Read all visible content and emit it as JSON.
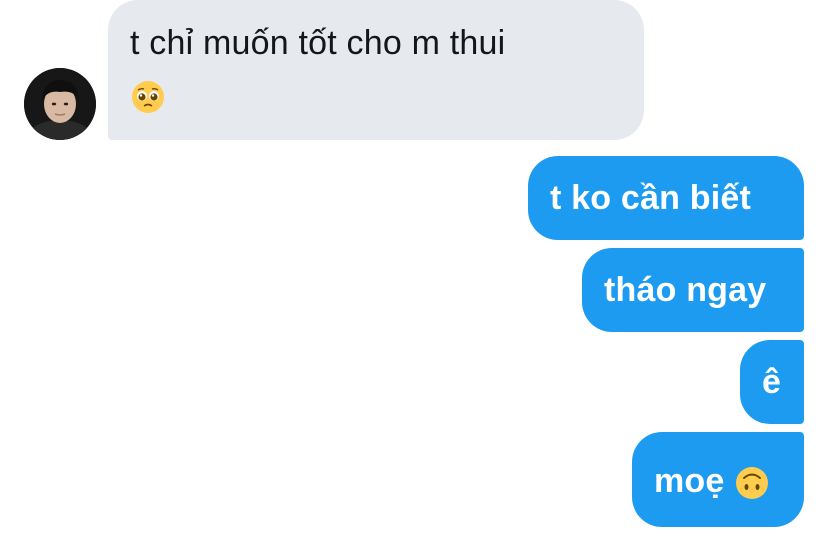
{
  "conversation": {
    "incoming": {
      "text": "t chỉ muốn tốt cho m thui",
      "emoji": "pleading-face-icon"
    },
    "outgoing": [
      {
        "text": "t ko cần biết"
      },
      {
        "text": "tháo ngay"
      },
      {
        "text": "ê"
      },
      {
        "text": "moẹ",
        "emoji": "upside-down-face-icon"
      }
    ]
  },
  "colors": {
    "incoming_bubble": "#e6eaef",
    "outgoing_bubble": "#1d9bf0",
    "incoming_text": "#14171a",
    "outgoing_text": "#ffffff"
  }
}
